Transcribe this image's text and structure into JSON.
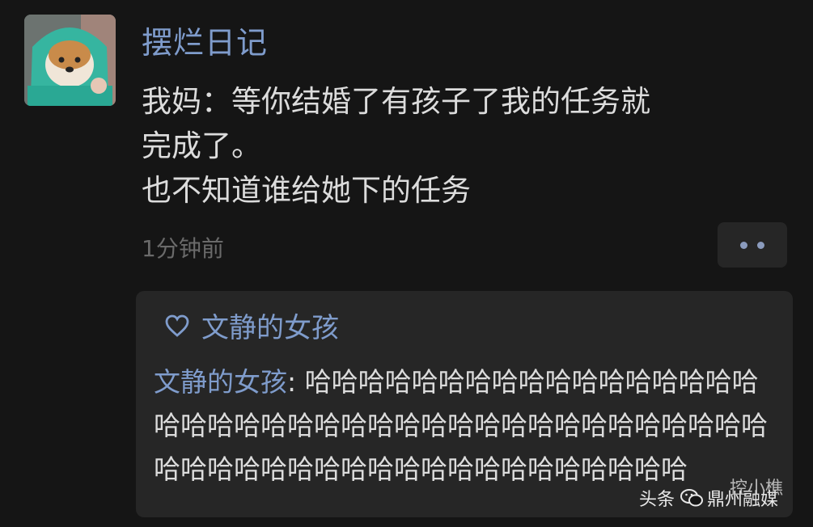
{
  "post": {
    "username": "摆烂日记",
    "text": "我妈：等你结婚了有孩子了我的任务就\n完成了。\n也不知道谁给她下的任务",
    "time": "1分钟前"
  },
  "interactions": {
    "likes": [
      "文静的女孩"
    ],
    "comments": [
      {
        "author": "文静的女孩",
        "separator": ": ",
        "text": "哈哈哈哈哈哈哈哈哈哈哈哈哈哈哈哈哈哈哈哈哈哈哈哈哈哈哈哈哈哈哈哈哈哈哈哈哈哈哈哈哈哈哈哈哈哈哈哈哈哈哈哈哈哈哈哈哈哈哈哈"
      }
    ]
  },
  "watermark": {
    "platform": "头条",
    "account": "鼎州融媒",
    "handle": "控小樵"
  },
  "icons": {
    "like": "heart-icon",
    "more": "more-dots-icon",
    "watermark": "wechat-icon"
  },
  "colors": {
    "background": "#151515",
    "link_blue": "#7f9ccc",
    "panel": "#262626",
    "text": "#dcdcdc",
    "muted": "#6a6a6a"
  }
}
